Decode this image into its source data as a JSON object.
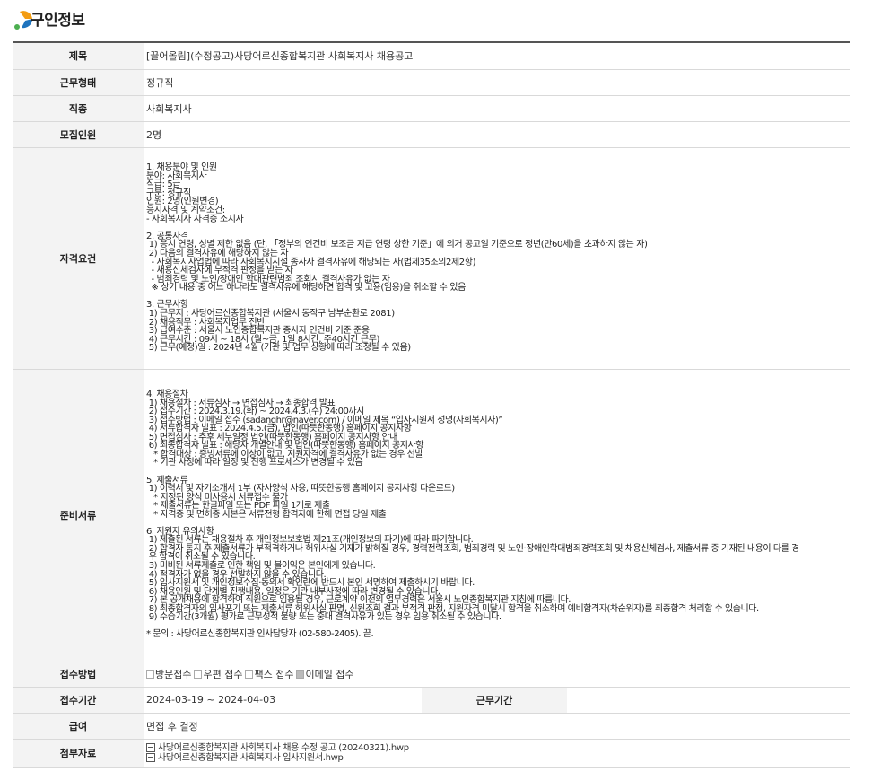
{
  "header": {
    "title": "구인정보"
  },
  "rows": {
    "title": {
      "label": "제목",
      "value": "[끌어올림](수정공고)사당어르신종합복지관 사회복지사 채용공고"
    },
    "employment_type": {
      "label": "근무형태",
      "value": "정규직"
    },
    "job_type": {
      "label": "직종",
      "value": "사회복지사"
    },
    "headcount": {
      "label": "모집인원",
      "value": "2명"
    },
    "requirements": {
      "label": "자격요건",
      "lines": [
        "1. 채용분야 및 인원",
        "분야: 사회복지사",
        "직급: 5급",
        "구분: 정규직",
        "인원: 2명(인원변경)",
        "응시자격 및 계약조건:",
        "- 사회복지사 자격증 소지자",
        "",
        "2. 공통자격",
        " 1) 응시 연령, 성별 제한 없음 (단, 「정부의 인건비 보조금 지급 연령 상한 기준」에 의거 공고일 기준으로 정년(만60세)을 초과하지 않는 자)",
        " 2) 다음의 결격사유에 해당하지 않는 자",
        "  - 사회복지사업법에 따라 사회복지시설 종사자 결격사유에 해당되는 자(법제35조의2제2항)",
        "  - 채용신체검사에 부적격 판정을 받는 자",
        "  - 범죄경력 및 노인/장애인 학대관련범죄 조회시 결격사유가 없는 자",
        "  ※ 상기 내용 중 어느 하나라도 결격사유에 해당하면 합격 및 고용(임용)을 취소할 수 있음",
        "",
        "3. 근무사항",
        " 1) 근무지 : 사당어르신종합복지관 (서울시 동작구 남부순환로 2081)",
        " 2) 채용직무 : 사회복지업무 전반",
        " 3) 급여수준 : 서울시 노인종합복지관 종사자 인건비 기준 준용",
        " 4) 근무시간 : 09시 ~ 18시 (월~금, 1일 8시간, 주40시간 근무)",
        " 5) 근무(예정)일 : 2024년 4월 (기관 및 업무 상황에 따라 조정될 수 있음)"
      ]
    },
    "documents": {
      "label": "준비서류",
      "lines": [
        "4. 채용절차",
        " 1) 채용절차 : 서류심사 → 면접심사 → 최종합격 발표",
        " 2) 접수기간 : 2024.3.19.(화) ~ 2024.4.3.(수) 24:00까지",
        " 3) 접수방법 : 이메일 접수 (sadanghr@naver.com) / 이메일 제목 “입사지원서 성명(사회복지사)”",
        " 4) 서류합격자 발표 : 2024.4.5.(금), 법인(따뜻한동행) 홈페이지 공지사항",
        " 5) 면접심사 : 추후 세부일정 법인(따뜻한동행) 홈페이지 공지사항 안내",
        " 6) 최종합격자 발표 : 해당자 개별안내 및 법인(따뜻한동행) 홈페이지 공지사항",
        "   * 합격대상 : 증빙서류에 이상이 없고, 지원자격에 결격사유가 없는 경우 선발",
        "   * 기관 사정에 따라 일정 및 진행 프로세스가 변경될 수 있음",
        "",
        "5. 제출서류",
        " 1) 이력서 및 자기소개서 1부 (자사양식 사용, 따뜻한동행 홈페이지 공지사항 다운로드)",
        "   * 지정된 양식 미사용시 서류접수 불가",
        "   * 제출서류는 한글파일 또는 PDF 파일 1개로 제출",
        "   * 자격증 및 면허증 사본은 서류전형 합격자에 한해 면접 당일 제출",
        "",
        "6. 지원자 유의사항",
        " 1) 제출된 서류는 채용절차 후 개인정보보호법 제21조(개인정보의 파기)에 따라 파기합니다.",
        " 2) 합격자 통지 후 제출서류가 부적격하거나 허위사실 기재가 밝혀질 경우, 경력전력조회, 범죄경력 및 노인·장애인학대범죄경력조회 및 채용신체검사, 제출서류 중 기재된 내용이 다를 경",
        " 우 합격이 취소될 수 있습니다.",
        " 3) 미비된 서류제출로 인한 책임 및 불이익은 본인에게 있습니다.",
        " 4) 적격자가 없을 경우 선발하지 않을 수 있습니다.",
        " 5) 입사지원서 및 개인정보수집·동의서 확인란에 반드시 본인 서명하여 제출하시기 바랍니다.",
        " 6) 채용인원 및 단계별 진행내용, 일정은 기관 내부사정에 따라 변경될 수 있습니다.",
        " 7) 본 공개채용에 합격하여 직원으로 임용될 경우, 근로계약 이전의 업무경력은 서울시 노인종합복지관 지침에 따릅니다.",
        " 8) 최종합격자의 입사포기 또는 제출서류 허위사실 판명, 신원조회 결과 부적격 판정, 지원자격 미달시 합격을 취소하며 예비합격자(차순위자)를 최종합격 처리할 수 있습니다.",
        " 9) 수습기간(3개월) 평가로 근무성적 불량 또는 중대 결격사유가 있는 경우 임용 취소될 수 있습니다.",
        "",
        "* 문의 : 사당어르신종합복지관 인사담당자 (02-580-2405). 끝."
      ]
    },
    "apply_method": {
      "label": "접수방법",
      "options": [
        {
          "label": "방문접수",
          "checked": false
        },
        {
          "label": "우편 접수",
          "checked": false
        },
        {
          "label": "팩스 접수",
          "checked": false
        },
        {
          "label": "이메일 접수",
          "checked": true
        }
      ]
    },
    "apply_period": {
      "label": "접수기간",
      "value": "2024-03-19 ~ 2024-04-03",
      "work_period_label": "근무기간",
      "work_period_value": ""
    },
    "salary": {
      "label": "급여",
      "value": "면접 후 결정"
    },
    "attachments": {
      "label": "첨부자료",
      "files": [
        "사당어르신종합복지관 사회복지사 채용 수정 공고 (20240321).hwp",
        "사당어르신종합복지관 사회복지사 입사지원서.hwp"
      ]
    }
  },
  "colors": {
    "label_bg": "#f3f3f3",
    "border": "#d9d9d9",
    "top_border": "#555555",
    "logo_orange": "#f39c12",
    "logo_green": "#4caf50",
    "logo_blue": "#1e73be"
  }
}
